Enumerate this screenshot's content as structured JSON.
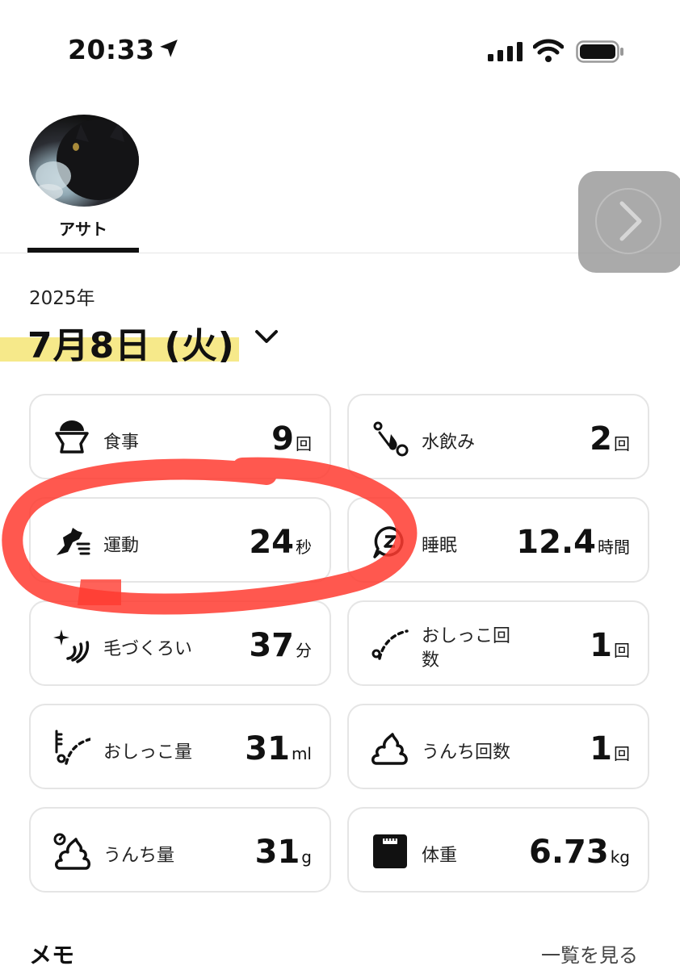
{
  "status_bar": {
    "time": "20:33"
  },
  "pet": {
    "name": "アサト"
  },
  "date": {
    "year": "2025年",
    "day": "7月8日 (火)"
  },
  "cards": [
    {
      "label": "食事",
      "value": "9",
      "unit": "回",
      "icon": "bowl-icon"
    },
    {
      "label": "水飲み",
      "value": "2",
      "unit": "回",
      "icon": "water-drop-icon"
    },
    {
      "label": "運動",
      "value": "24",
      "unit": "秒",
      "icon": "running-cat-icon"
    },
    {
      "label": "睡眠",
      "value": "12.4",
      "unit": "時間",
      "icon": "sleep-icon"
    },
    {
      "label": "毛づくろい",
      "value": "37",
      "unit": "分",
      "icon": "grooming-icon"
    },
    {
      "label": "おしっこ回数",
      "value": "1",
      "unit": "回",
      "icon": "pee-count-icon"
    },
    {
      "label": "おしっこ量",
      "value": "31",
      "unit": "ml",
      "icon": "pee-volume-icon"
    },
    {
      "label": "うんち回数",
      "value": "1",
      "unit": "回",
      "icon": "poop-icon"
    },
    {
      "label": "うんち量",
      "value": "31",
      "unit": "g",
      "icon": "poop-weight-icon"
    },
    {
      "label": "体重",
      "value": "6.73",
      "unit": "kg",
      "icon": "scale-icon"
    }
  ],
  "memo": {
    "title": "メモ",
    "view_all": "一覧を見る"
  },
  "colors": {
    "highlight": "#f6e98a",
    "annotation": "#ff3b30",
    "card_border": "#e5e5e5"
  }
}
